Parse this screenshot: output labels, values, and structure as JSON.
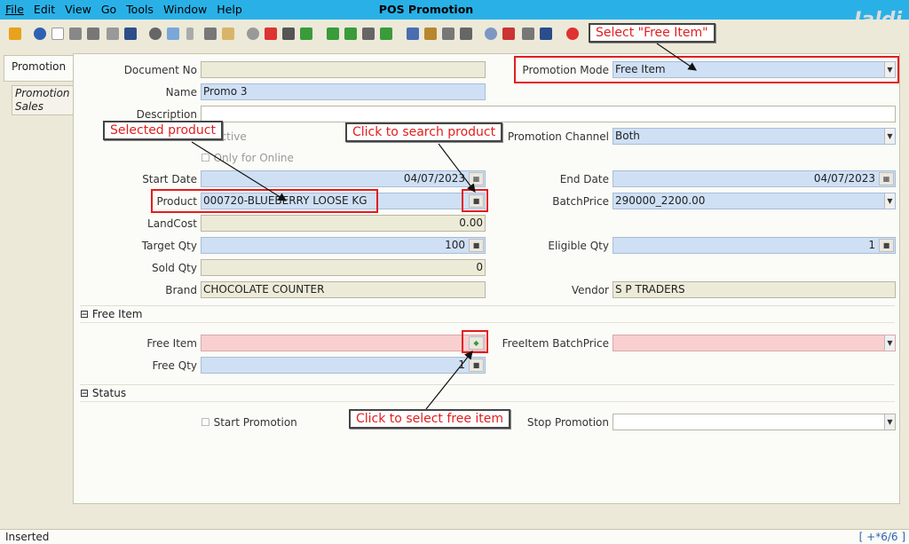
{
  "menu": {
    "file": "File",
    "edit": "Edit",
    "view": "View",
    "go": "Go",
    "tools": "Tools",
    "window": "Window",
    "help": "Help"
  },
  "window_title": "POS Promotion",
  "brand_logo": "Jaldi",
  "tabs": {
    "promotion": "Promotion",
    "promotion_sales": "Promotion Sales"
  },
  "form": {
    "document_no_label": "Document No",
    "document_no": "",
    "name_label": "Name",
    "name": "Promo 3",
    "description_label": "Description",
    "description": "",
    "active_label": "Active",
    "only_online_label": "Only for Online",
    "start_date_label": "Start Date",
    "start_date": "04/07/2023",
    "product_label": "Product",
    "product": "000720-BLUEBERRY LOOSE KG",
    "landcost_label": "LandCost",
    "landcost": "0.00",
    "target_qty_label": "Target Qty",
    "target_qty": "100",
    "sold_qty_label": "Sold Qty",
    "sold_qty": "0",
    "brand_label": "Brand",
    "brand": "CHOCOLATE COUNTER",
    "promotion_mode_label": "Promotion Mode",
    "promotion_mode": "Free Item",
    "promotion_channel_label": "Promotion Channel",
    "promotion_channel": "Both",
    "end_date_label": "End Date",
    "end_date": "04/07/2023",
    "batch_price_label": "BatchPrice",
    "batch_price": "290000_2200.00",
    "eligible_qty_label": "Eligible Qty",
    "eligible_qty": "1",
    "vendor_label": "Vendor",
    "vendor": "S P TRADERS"
  },
  "free_item_section": {
    "title": "Free Item",
    "free_item_label": "Free Item",
    "free_item": "",
    "free_qty_label": "Free Qty",
    "free_qty": "1",
    "freeitem_batchprice_label": "FreeItem BatchPrice",
    "freeitem_batchprice": ""
  },
  "status_section": {
    "title": "Status",
    "start_promotion_label": "Start Promotion",
    "stop_promotion_label": "Stop Promotion",
    "stop_promotion": ""
  },
  "annotations": {
    "select_free_item": "Select \"Free Item\"",
    "selected_product": "Selected product",
    "search_product": "Click to search product",
    "select_free": "Click to select free item"
  },
  "statusbar": {
    "left": "Inserted",
    "right": "[ +*6/6 ]"
  }
}
